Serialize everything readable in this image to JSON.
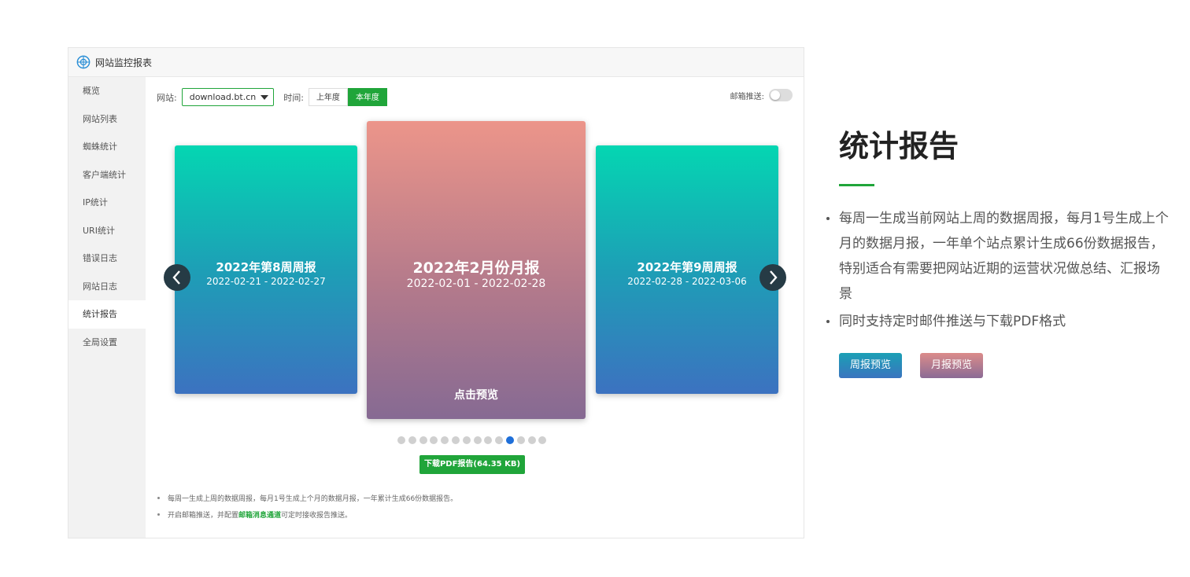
{
  "panel": {
    "title": "网站监控报表",
    "sidebar": [
      "概览",
      "网站列表",
      "蜘蛛统计",
      "客户端统计",
      "IP统计",
      "URI统计",
      "错误日志",
      "网站日志",
      "统计报告",
      "全局设置"
    ],
    "active_item": "统计报告"
  },
  "filters": {
    "site_label": "网站:",
    "site_value": "download.bt.cn",
    "time_label": "时间:",
    "last_year": "上年度",
    "this_year": "本年度",
    "mail_push_label": "邮箱推送:"
  },
  "cards": {
    "left": {
      "title": "2022年第8周周报",
      "range": "2022-02-21 - 2022-02-27"
    },
    "center": {
      "title": "2022年2月份月报",
      "range": "2022-02-01 - 2022-02-28",
      "preview": "点击预览"
    },
    "right": {
      "title": "2022年第9周周报",
      "range": "2022-02-28 - 2022-03-06"
    }
  },
  "pagination": {
    "total": 14,
    "active": 11
  },
  "download_button": "下载PDF报告(64.35 KB)",
  "notes": {
    "line1": "每周一生成上周的数据周报，每月1号生成上个月的数据月报，一年累计生成66份数据报告。",
    "line2_prefix": "开启邮箱推送，并配置",
    "line2_link": "邮箱消息通道",
    "line2_suffix": "可定时接收报告推送。"
  },
  "feature": {
    "title": "统计报告",
    "bullets": [
      "每周一生成当前网站上周的数据周报，每月1号生成上个月的数据月报，一年单个站点累计生成66份数据报告，特别适合有需要把网站近期的运营状况做总结、汇报场景",
      "同时支持定时邮件推送与下载PDF格式"
    ],
    "weekly_button": "周报预览",
    "monthly_button": "月报预览"
  },
  "colors": {
    "accent": "#20a53a",
    "active_dot": "#1e6fd9"
  }
}
